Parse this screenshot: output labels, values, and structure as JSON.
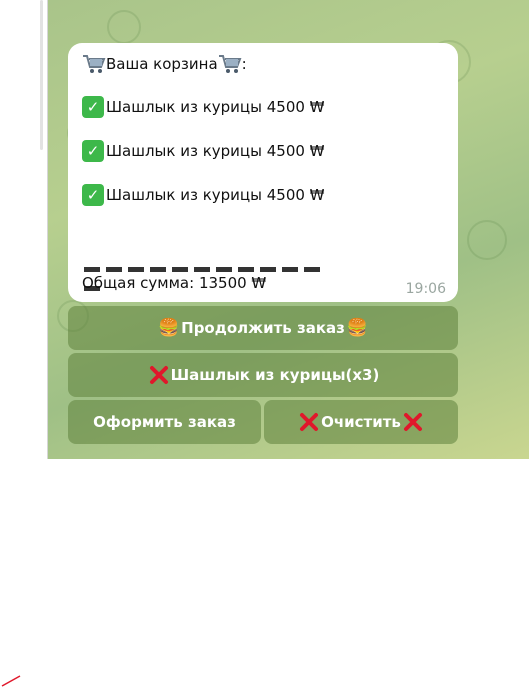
{
  "message": {
    "header_text": "Ваша корзина",
    "header_suffix": ":",
    "items": [
      "Шашлык из курицы 4500 ₩",
      "Шашлык из курицы 4500 ₩",
      "Шашлык из курицы 4500 ₩"
    ],
    "total": "Общая сумма: 13500 ₩",
    "time": "19:06"
  },
  "keyboard": {
    "continue_label": "Продолжить заказ",
    "remove_item_label": "Шашлык из курицы(x3)",
    "checkout_label": "Оформить заказ",
    "clear_label": "Очистить"
  },
  "icons": {
    "cart": "shopping-cart-icon",
    "check": "check-mark-icon",
    "burger": "burger-icon",
    "cross": "red-cross-icon"
  },
  "colors": {
    "check_green": "#3db84a",
    "cross_red": "#e0182b",
    "button_bg": "#6b8f45"
  }
}
